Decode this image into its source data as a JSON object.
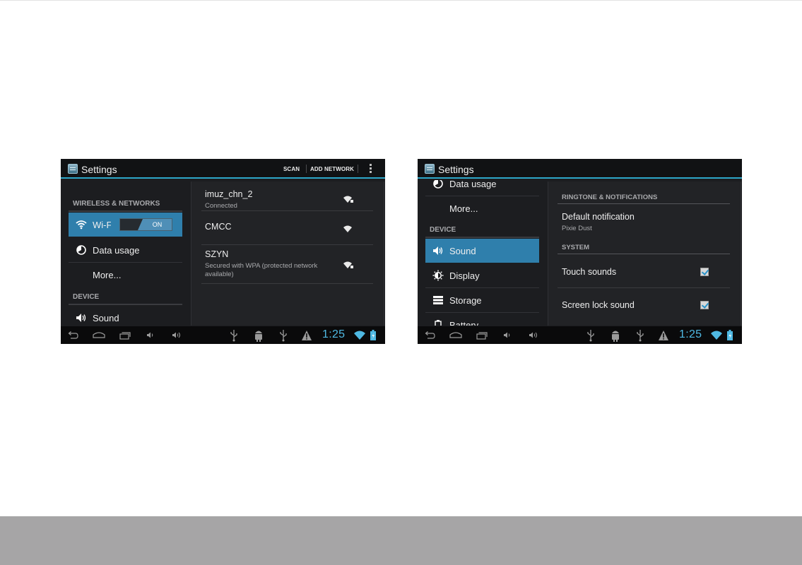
{
  "colors": {
    "accent": "#2da7c9",
    "selected": "#2f7fac",
    "background": "#1c1d20",
    "footer": "#a6a5a6",
    "clock": "#4fb9e3"
  },
  "screen1": {
    "title": "Settings",
    "actions": [
      "SCAN",
      "ADD NETWORK"
    ],
    "overflow_icon": "overflow-menu-icon",
    "sidebar": {
      "section_wireless": "WIRELESS & NETWORKS",
      "wifi_label": "Wi-Fi",
      "wifi_toggle": "ON",
      "data_usage": "Data usage",
      "more": "More...",
      "section_device": "DEVICE",
      "sound": "Sound"
    },
    "networks": [
      {
        "name": "imuz_chn_2",
        "status": "Connected",
        "icon": "wifi-locked-icon"
      },
      {
        "name": "CMCC",
        "status": "",
        "icon": "wifi-icon"
      },
      {
        "name": "SZYN",
        "status": "Secured with WPA (protected network available)",
        "icon": "wifi-locked-icon"
      }
    ],
    "status_bar": {
      "time": "1:25"
    }
  },
  "screen2": {
    "title": "Settings",
    "sidebar": {
      "data_usage": "Data usage",
      "more": "More...",
      "section_device": "DEVICE",
      "sound": "Sound",
      "display": "Display",
      "storage": "Storage",
      "battery": "Battery"
    },
    "prefs": {
      "section_ringtone": "RINGTONE & NOTIFICATIONS",
      "default_notification": "Default notification",
      "default_notification_value": "Pixie Dust",
      "section_system": "SYSTEM",
      "touch_sounds": "Touch sounds",
      "touch_sounds_checked": true,
      "screen_lock_sound": "Screen lock sound",
      "screen_lock_sound_checked": true
    },
    "status_bar": {
      "time": "1:25"
    }
  }
}
